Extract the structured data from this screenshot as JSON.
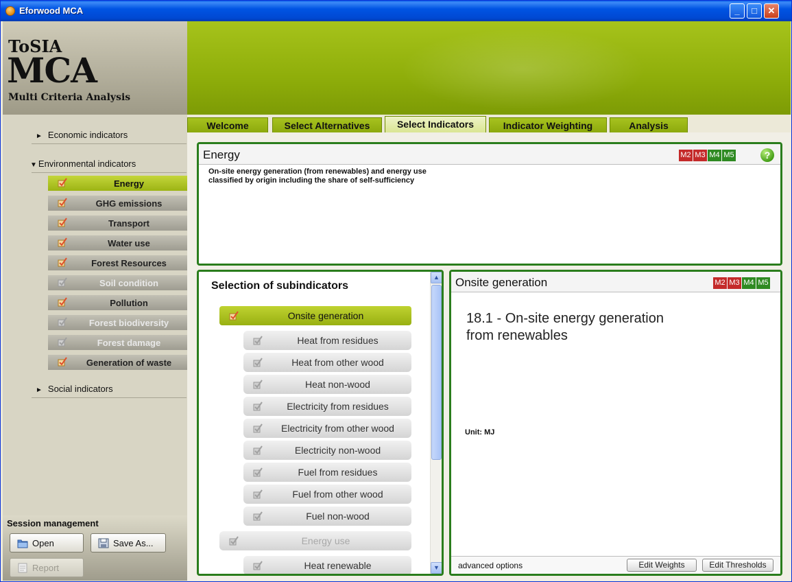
{
  "window": {
    "title": "Eforwood MCA",
    "min": "_",
    "max": "□",
    "close": "✕"
  },
  "logo": {
    "line1": "ToSIA",
    "line2": "MCA",
    "line3": "Multi Criteria Analysis"
  },
  "sidebar": {
    "economic": "Economic indicators",
    "environmental": "Environmental indicators",
    "social": "Social indicators",
    "arrow_collapsed": "►",
    "arrow_expanded": "▼",
    "items": [
      {
        "label": "Energy",
        "state": "active"
      },
      {
        "label": "GHG emissions",
        "state": "normal"
      },
      {
        "label": "Transport",
        "state": "normal"
      },
      {
        "label": "Water use",
        "state": "normal"
      },
      {
        "label": "Forest Resources",
        "state": "normal"
      },
      {
        "label": "Soil condition",
        "state": "disabled"
      },
      {
        "label": "Pollution",
        "state": "normal"
      },
      {
        "label": "Forest biodiversity",
        "state": "disabled"
      },
      {
        "label": "Forest damage",
        "state": "disabled"
      },
      {
        "label": "Generation of waste",
        "state": "normal"
      }
    ]
  },
  "session": {
    "title": "Session management",
    "open": "Open",
    "save_as": "Save As...",
    "report": "Report"
  },
  "tabs": [
    "Welcome",
    "Select Alternatives",
    "Select Indicators",
    "Indicator Weighting",
    "Analysis"
  ],
  "energy_panel": {
    "title": "Energy",
    "badges": [
      "M2",
      "M3",
      "M4",
      "M5"
    ],
    "help": "?",
    "description_line1": "On-site energy generation (from renewables) and energy use",
    "description_line2": "classified by origin including the share of self-sufficiency"
  },
  "subindicators": {
    "title": "Selection of subindicators",
    "items": [
      {
        "label": "Onsite generation",
        "kind": "main"
      },
      {
        "label": "Heat from residues",
        "kind": "child"
      },
      {
        "label": "Heat from other wood",
        "kind": "child"
      },
      {
        "label": "Heat non-wood",
        "kind": "child"
      },
      {
        "label": "Electricity from residues",
        "kind": "child"
      },
      {
        "label": "Electricity from other wood",
        "kind": "child"
      },
      {
        "label": "Electricity non-wood",
        "kind": "child"
      },
      {
        "label": "Fuel from residues",
        "kind": "child"
      },
      {
        "label": "Fuel from other wood",
        "kind": "child"
      },
      {
        "label": "Fuel non-wood",
        "kind": "child"
      },
      {
        "label": "Energy use",
        "kind": "gray"
      },
      {
        "label": "Heat renewable",
        "kind": "child"
      }
    ]
  },
  "detail": {
    "title": "Onsite generation",
    "badges": [
      "M2",
      "M3",
      "M4",
      "M5"
    ],
    "heading_line1": "18.1 - On-site energy generation",
    "heading_line2": "from renewables",
    "unit": "Unit: MJ",
    "advanced": "advanced options",
    "edit_weights": "Edit Weights",
    "edit_thresholds": "Edit Thresholds"
  },
  "colors": {
    "accent": "#9cb414",
    "panel_border": "#2a7d1c",
    "badge_red": "#c42a2a",
    "badge_green": "#2e8a22",
    "titlebar": "#0054e3"
  }
}
